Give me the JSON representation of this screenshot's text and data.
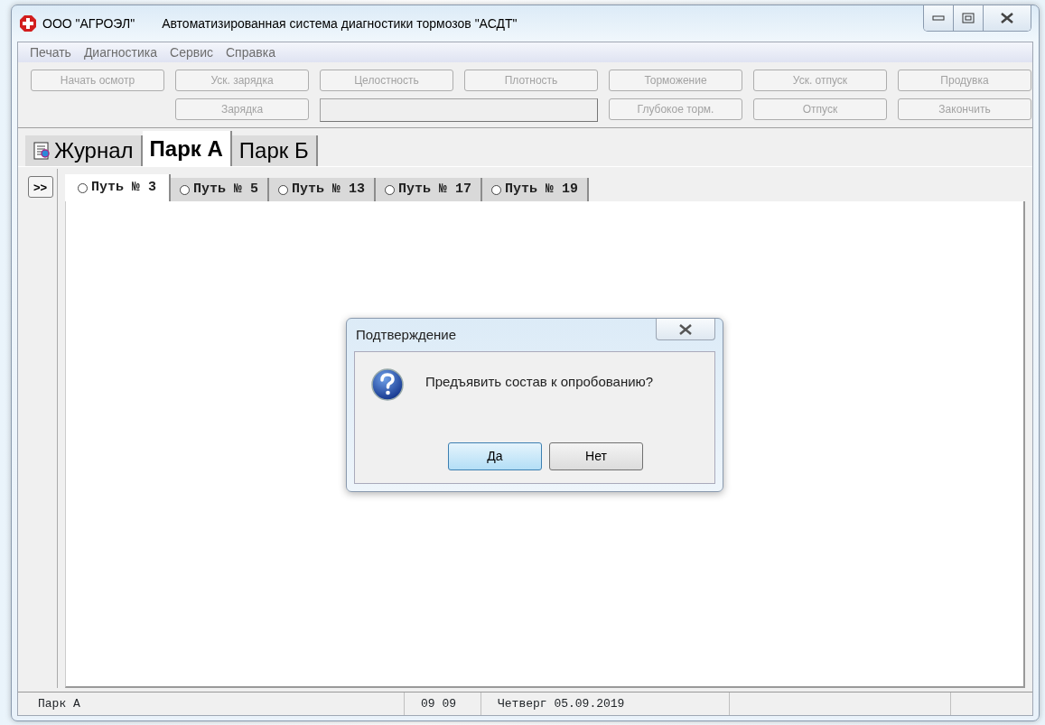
{
  "window": {
    "app_name": "ООО \"АГРОЭЛ\"",
    "title": "Автоматизированная система диагностики тормозов \"АСДТ\""
  },
  "menu": [
    "Печать",
    "Диагностика",
    "Сервис",
    "Справка"
  ],
  "toolbar": {
    "row_1": [
      {
        "kind": "button",
        "label": "Начать осмотр",
        "disabled": true
      },
      {
        "kind": "button",
        "label": "Уск. зарядка",
        "disabled": true
      },
      {
        "kind": "button",
        "label": "Целостность",
        "disabled": true
      },
      {
        "kind": "button",
        "label": "Плотность",
        "disabled": true
      },
      {
        "kind": "button",
        "label": "Торможение",
        "disabled": true
      },
      {
        "kind": "button",
        "label": "Уск. отпуск",
        "disabled": true
      },
      {
        "kind": "button",
        "label": "Продувка",
        "disabled": true
      }
    ],
    "row_2": [
      {
        "kind": "button",
        "label": "Зарядка",
        "disabled": true
      },
      {
        "kind": "field"
      },
      {
        "kind": "button",
        "label": "Глубокое торм.",
        "disabled": true
      },
      {
        "kind": "button",
        "label": "Отпуск",
        "disabled": true
      },
      {
        "kind": "button",
        "label": "Закончить",
        "disabled": true
      }
    ]
  },
  "park_tabs": [
    {
      "label": "Журнал",
      "selected": false,
      "icon": true
    },
    {
      "label": "Парк А",
      "selected": true,
      "icon": false
    },
    {
      "label": "Парк Б",
      "selected": false,
      "icon": false
    }
  ],
  "side_button": ">>",
  "track_tabs": [
    {
      "label": "Путь № 3",
      "selected": true
    },
    {
      "label": "Путь № 5",
      "selected": false
    },
    {
      "label": "Путь № 13",
      "selected": false
    },
    {
      "label": "Путь № 17",
      "selected": false
    },
    {
      "label": "Путь № 19",
      "selected": false
    }
  ],
  "dialog": {
    "title": "Подтверждение",
    "message": "Предъявить состав к опробованию?",
    "buttons": [
      {
        "label": "Да",
        "selected": true
      },
      {
        "label": "Нет",
        "selected": false
      }
    ]
  },
  "status_bar": [
    "Парк А",
    "09 09",
    "Четверг 05.09.2019"
  ]
}
